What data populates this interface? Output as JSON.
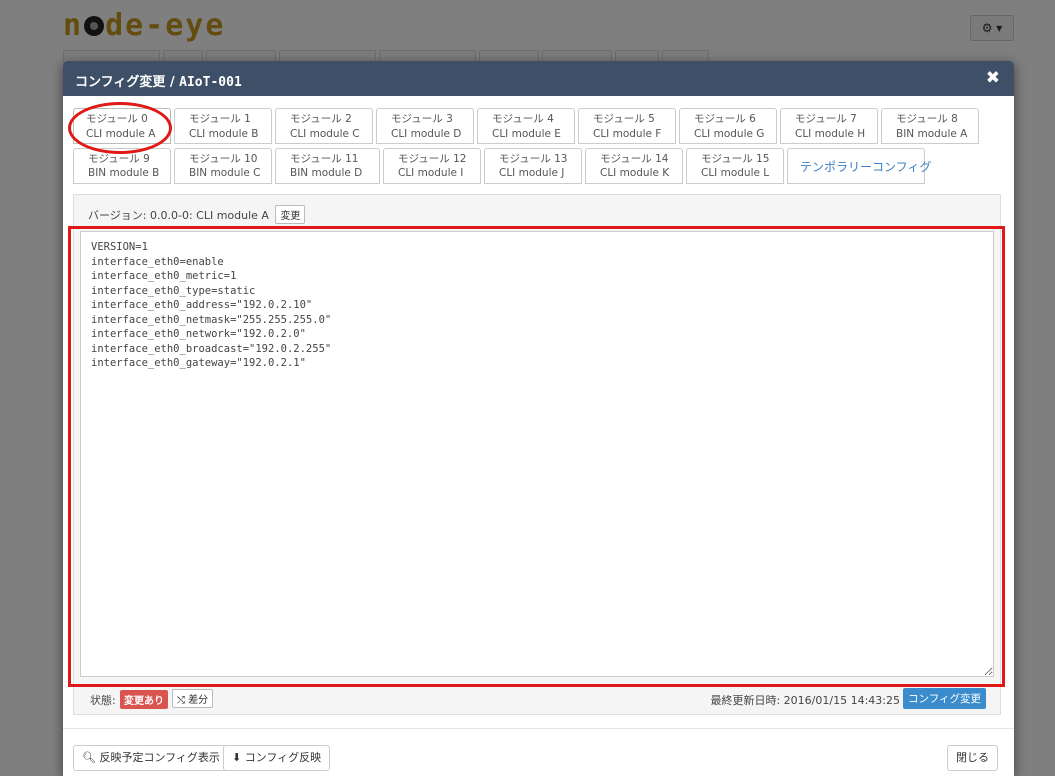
{
  "background": {
    "logo": "n•de-eye",
    "gear_label": "⚙ ▾"
  },
  "modal": {
    "title_prefix": "コンフィグ変更 / ",
    "title_device": "AIoT-001",
    "close_icon": "✖"
  },
  "tabs_row1": [
    {
      "l1": "モジュール 0",
      "l2": "CLI module A"
    },
    {
      "l1": "モジュール 1",
      "l2": "CLI module B"
    },
    {
      "l1": "モジュール 2",
      "l2": "CLI module C"
    },
    {
      "l1": "モジュール 3",
      "l2": "CLI module D"
    },
    {
      "l1": "モジュール 4",
      "l2": "CLI module E"
    },
    {
      "l1": "モジュール 5",
      "l2": "CLI module F"
    },
    {
      "l1": "モジュール 6",
      "l2": "CLI module G"
    },
    {
      "l1": "モジュール 7",
      "l2": "CLI module H"
    },
    {
      "l1": "モジュール 8",
      "l2": "BIN module A"
    }
  ],
  "tabs_row2": [
    {
      "l1": "モジュール 9",
      "l2": "BIN module B"
    },
    {
      "l1": "モジュール 10",
      "l2": "BIN module C"
    },
    {
      "l1": "モジュール 11",
      "l2": "BIN module D"
    },
    {
      "l1": "モジュール 12",
      "l2": "CLI module I"
    },
    {
      "l1": "モジュール 13",
      "l2": "CLI module J"
    },
    {
      "l1": "モジュール 14",
      "l2": "CLI module K"
    },
    {
      "l1": "モジュール 15",
      "l2": "CLI module L"
    }
  ],
  "temp_tab": "テンポラリーコンフィグ",
  "version": {
    "text": "バージョン: 0.0.0-0: CLI module A",
    "change_button": "変更"
  },
  "config_text": "VERSION=1\ninterface_eth0=enable\ninterface_eth0_metric=1\ninterface_eth0_type=static\ninterface_eth0_address=\"192.0.2.10\"\ninterface_eth0_netmask=\"255.255.255.0\"\ninterface_eth0_network=\"192.0.2.0\"\ninterface_eth0_broadcast=\"192.0.2.255\"\ninterface_eth0_gateway=\"192.0.2.1\"",
  "status": {
    "label": "状態:",
    "badge": "変更あり",
    "diff_button": "⤭ 差分",
    "updated": "最終更新日時: 2016/01/15 14:43:25",
    "apply_button": "コンフィグ変更"
  },
  "footer": {
    "preview_button": "反映予定コンフィグ表示",
    "apply_button": "コンフィグ反映",
    "close_button": "閉じる"
  },
  "colors": {
    "header_bg": "#3d5068",
    "annotation_red": "#e01818",
    "badge_red": "#d9534f",
    "button_blue": "#3b8ccc"
  }
}
